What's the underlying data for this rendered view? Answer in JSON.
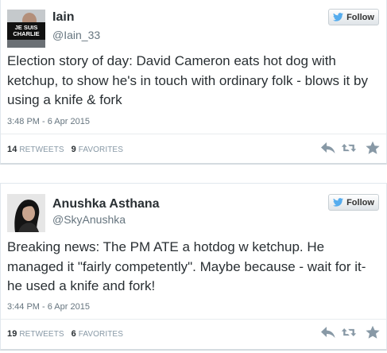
{
  "tweets": [
    {
      "name": "Iain",
      "handle": "@Iain_33",
      "avatar_text_1": "JE SUIS",
      "avatar_text_2": "CHARLIE",
      "follow_label": "Follow",
      "text": "Election story of day: David Cameron eats hot dog with ketchup, to show he's in touch with ordinary folk - blows it by using a knife & fork",
      "time": "3:48 PM - 6 Apr 2015",
      "retweets": "14",
      "retweets_label": "RETWEETS",
      "favorites": "9",
      "favorites_label": "FAVORITES"
    },
    {
      "name": "Anushka Asthana",
      "handle": "@SkyAnushka",
      "follow_label": "Follow",
      "text": "Breaking news: The PM ATE a hotdog w ketchup. He managed it \"fairly competently\". Maybe because - wait for it- he used a knife and fork!",
      "time": "3:44 PM - 6 Apr 2015",
      "retweets": "19",
      "retweets_label": "RETWEETS",
      "favorites": "6",
      "favorites_label": "FAVORITES"
    }
  ],
  "colors": {
    "twitter_blue": "#55acee",
    "action_gray": "#8899a6",
    "text_dark": "#292f33",
    "text_muted": "#66757f"
  },
  "icons": {
    "follow": "twitter-bird-icon",
    "reply": "reply-icon",
    "retweet": "retweet-icon",
    "favorite": "star-icon"
  }
}
